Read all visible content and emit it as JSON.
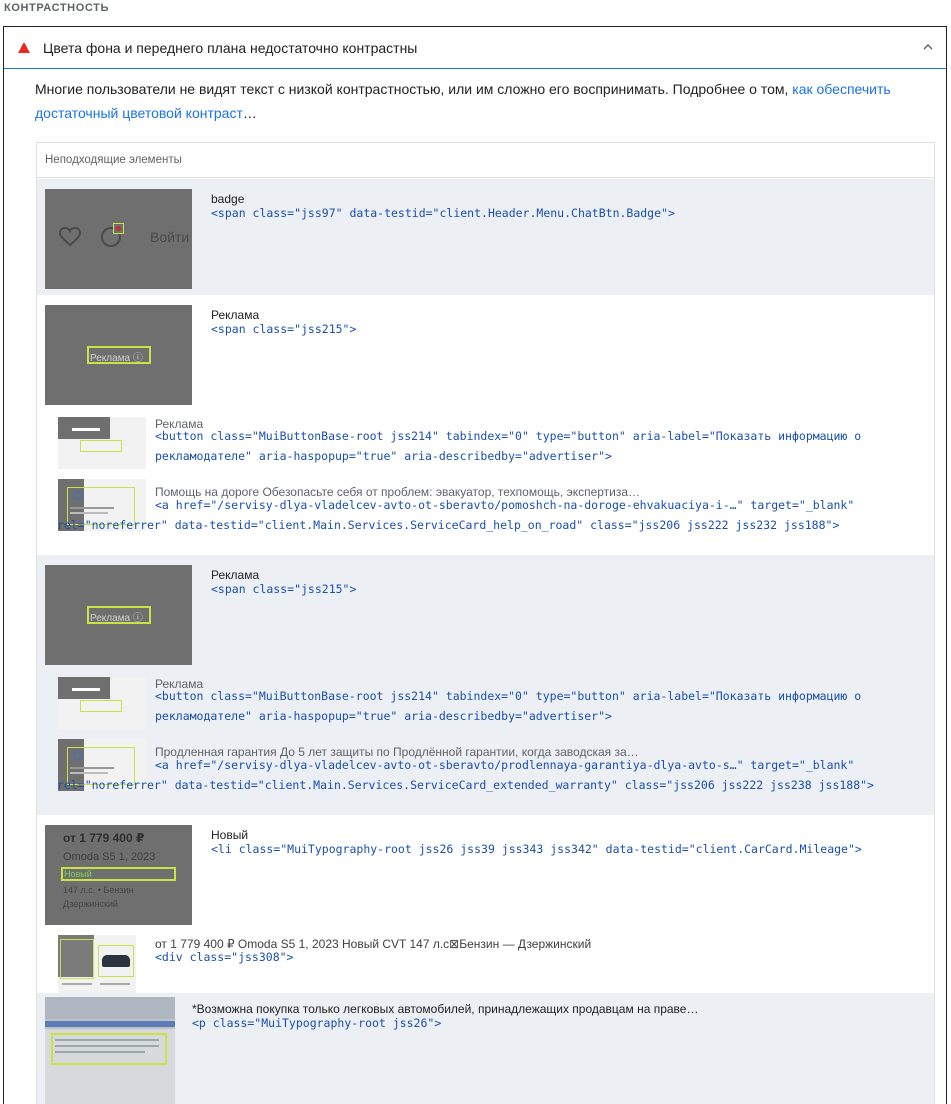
{
  "section": {
    "title": "КОНТРАСТНОСТЬ"
  },
  "audit": {
    "title": "Цвета фона и переднего плана недостаточно контрастны",
    "description_text": "Многие пользователи не видят текст с низкой контрастностью, или им сложно его воспринимать. Подробнее о том, ",
    "description_link": "как обеспечить достаточный цветовой контраст",
    "description_suffix": "…",
    "table_header": "Неподходящие элементы"
  },
  "items": [
    {
      "name": "badge",
      "code": "<span class=\"jss97\" data-testid=\"client.Header.Menu.ChatBtn.Badge\">",
      "thumb_text": "Войти"
    },
    {
      "name": "Реклама",
      "code": "<span class=\"jss215\">",
      "thumb_text": "Реклама ⓘ"
    },
    {
      "name": "Реклама",
      "code": "<button class=\"MuiButtonBase-root jss214\" tabindex=\"0\" type=\"button\" aria-label=\"Показать информацию о рекламодателе\" aria-haspopup=\"true\" aria-describedby=\"advertiser\">"
    },
    {
      "name": "Помощь на дороге Обезопасьте себя от проблем: эвакуатор, техпомощь, экспертиза…",
      "code": "<a href=\"/servisy-dlya-vladelcev-avto-ot-sberavto/pomoshch-na-doroge-ehvakuaciya-i-…\" target=\"_blank\" rel=\"noreferrer\" data-testid=\"client.Main.Services.ServiceCard_help_on_road\" class=\"jss206 jss222 jss232 jss188\">"
    },
    {
      "name": "Реклама",
      "code": "<span class=\"jss215\">",
      "thumb_text": "Реклама ⓘ"
    },
    {
      "name": "Реклама",
      "code": "<button class=\"MuiButtonBase-root jss214\" tabindex=\"0\" type=\"button\" aria-label=\"Показать информацию о рекламодателе\" aria-haspopup=\"true\" aria-describedby=\"advertiser\">"
    },
    {
      "name": "Продленная гарантия До 5 лет защиты по Продлённой гарантии, когда заводская за…",
      "code": "<a href=\"/servisy-dlya-vladelcev-avto-ot-sberavto/prodlennaya-garantiya-dlya-avto-s…\" target=\"_blank\" rel=\"noreferrer\" data-testid=\"client.Main.Services.ServiceCard_extended_warranty\" class=\"jss206 jss222 jss238 jss188\">"
    },
    {
      "name": "Новый",
      "code": "<li class=\"MuiTypography-root jss26 jss39 jss343 jss342\" data-testid=\"client.CarCard.Mileage\">",
      "thumb_price": "от 1 779 400 ₽",
      "thumb_model": "Omoda S5 1, 2023",
      "thumb_new": "Новый",
      "thumb_spec": "147 л.с. • Бензин",
      "thumb_city": "Дзержинский"
    },
    {
      "name": "от 1 779 400 ₽ Omoda S5 1, 2023 Новый CVT 147 л.с⊠Бензин — Дзержинский",
      "code": "<div class=\"jss308\">"
    },
    {
      "name": "*Возможна покупка только легковых автомобилей, принадлежащих продавцам на праве…",
      "code": "<p class=\"MuiTypography-root jss26\">"
    }
  ],
  "colors": {
    "fail": "#e8291c",
    "link": "#1a73e8",
    "code": "#1a4fb0",
    "highlight": "#c6e544",
    "row_shade": "#eceff3"
  }
}
